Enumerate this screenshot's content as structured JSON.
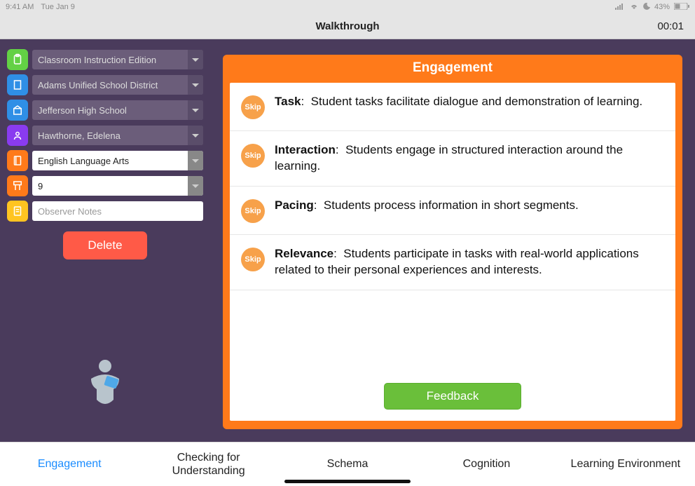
{
  "status_bar": {
    "time": "9:41 AM",
    "date": "Tue Jan 9",
    "battery": "43%"
  },
  "header": {
    "title": "Walkthrough",
    "timer": "00:01"
  },
  "sidebar": {
    "fields": [
      {
        "value": "Classroom Instruction Edition",
        "icon_bg": "#63d145"
      },
      {
        "value": "Adams Unified School District",
        "icon_bg": "#2f8fe6"
      },
      {
        "value": "Jefferson High School",
        "icon_bg": "#2f8fe6"
      },
      {
        "value": "Hawthorne, Edelena",
        "icon_bg": "#8a3bf0"
      },
      {
        "value": "English Language Arts",
        "icon_bg": "#ff7a1a"
      },
      {
        "value": "9",
        "icon_bg": "#ff7a1a"
      },
      {
        "placeholder": "Observer Notes",
        "icon_bg": "#ffc421"
      }
    ],
    "delete_label": "Delete"
  },
  "panel": {
    "title": "Engagement",
    "skip_label": "Skip",
    "criteria": [
      {
        "name": "Task",
        "desc": "Student tasks facilitate dialogue and demonstration of learning."
      },
      {
        "name": "Interaction",
        "desc": "Students engage in structured interaction around the learning."
      },
      {
        "name": "Pacing",
        "desc": "Students process information in short segments."
      },
      {
        "name": "Relevance",
        "desc": "Students participate in tasks with real-world applications related to their personal experiences and interests."
      }
    ],
    "feedback_label": "Feedback"
  },
  "tabs": {
    "items": [
      "Engagement",
      "Checking for Understanding",
      "Schema",
      "Cognition",
      "Learning Environment"
    ],
    "active_index": 0
  }
}
